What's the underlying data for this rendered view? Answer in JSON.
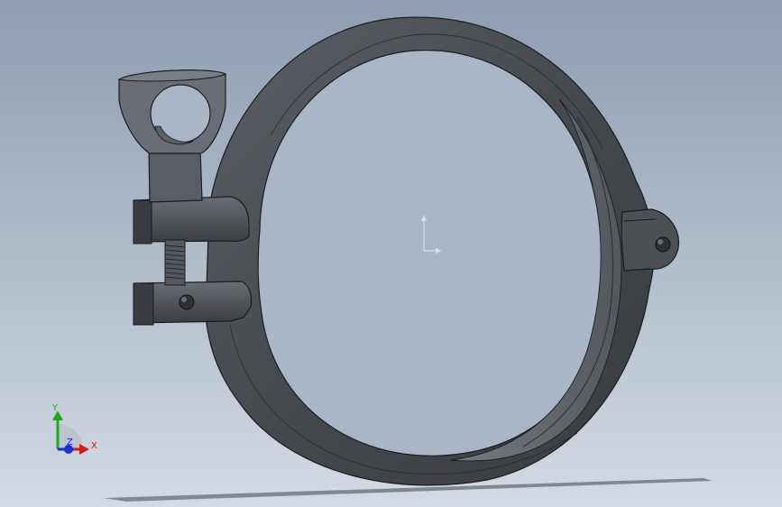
{
  "viewport": {
    "background_top": "#8e9db3",
    "background_bottom": "#d2dae3"
  },
  "model": {
    "part_color": "#4a4d52",
    "edge_color": "#1b1c1f",
    "highlight_color": "#6d7076"
  },
  "triad": {
    "x_label": "X",
    "y_label": "Y",
    "z_label": "Z",
    "x_color": "#d11a1a",
    "y_color": "#1fa81f",
    "z_color": "#1a2fd1"
  },
  "origin_marker": {
    "color": "#d6dde6"
  }
}
